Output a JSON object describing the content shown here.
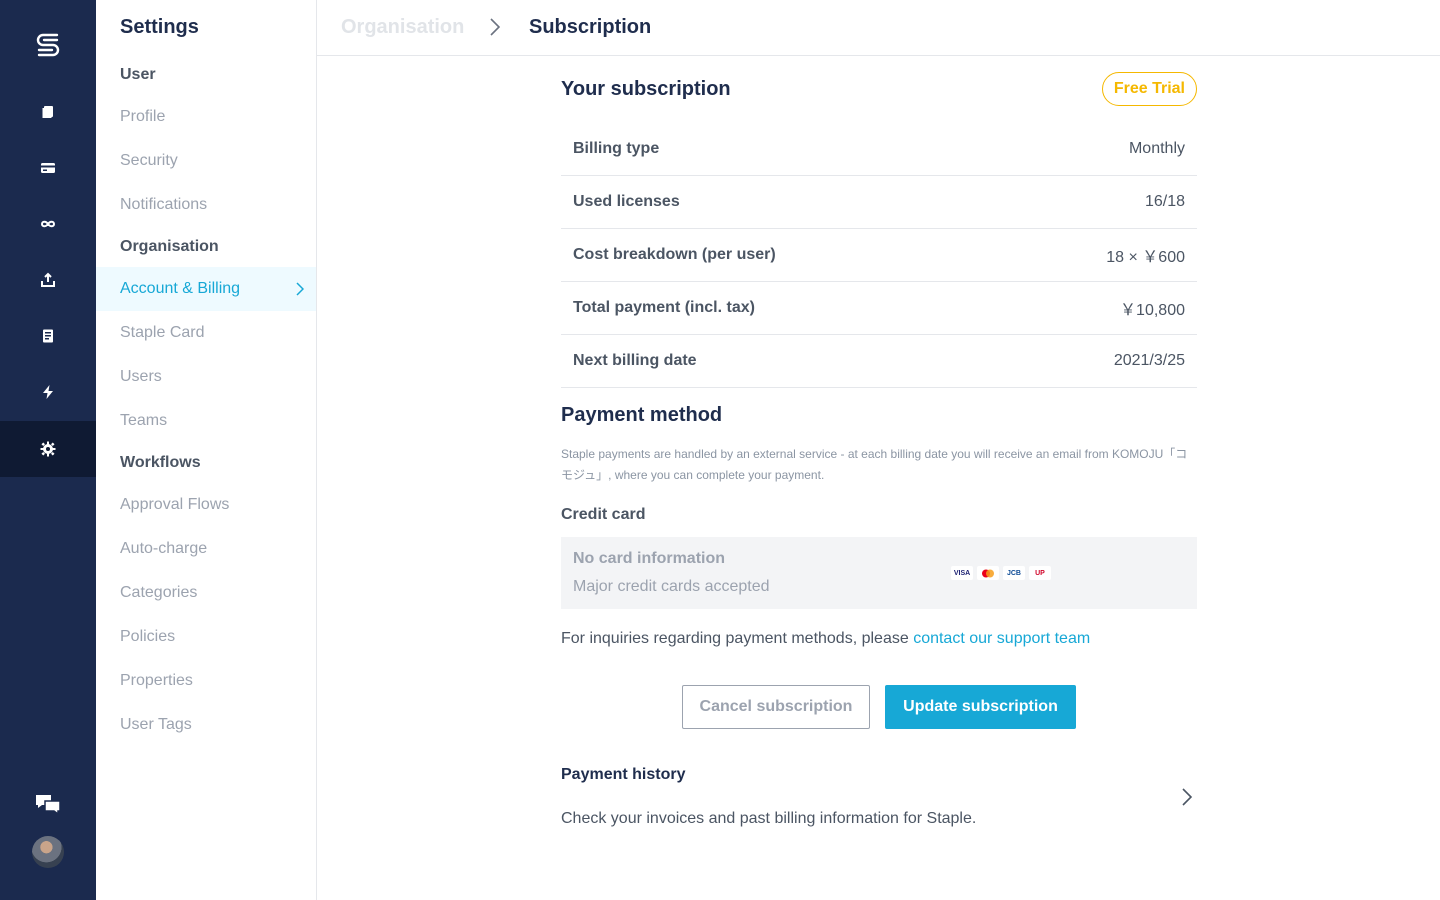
{
  "rail": {
    "logo": "staple-logo",
    "items": [
      {
        "icon": "documents-icon"
      },
      {
        "icon": "card-icon"
      },
      {
        "icon": "link-icon"
      },
      {
        "icon": "upload-icon"
      },
      {
        "icon": "receipt-icon"
      },
      {
        "icon": "bolt-icon"
      },
      {
        "icon": "gear-icon",
        "active": true
      }
    ],
    "chat_icon": "chat-icon",
    "avatar": "avatar"
  },
  "sidebar": {
    "title": "Settings",
    "sections": {
      "user": "User",
      "organisation": "Organisation",
      "workflows": "Workflows"
    },
    "items": [
      {
        "label": "Profile"
      },
      {
        "label": "Security"
      },
      {
        "label": "Notifications"
      },
      {
        "label": "Account & Billing",
        "active": true
      },
      {
        "label": "Staple Card"
      },
      {
        "label": "Users"
      },
      {
        "label": "Teams"
      },
      {
        "label": "Approval Flows"
      },
      {
        "label": "Auto-charge"
      },
      {
        "label": "Categories"
      },
      {
        "label": "Policies"
      },
      {
        "label": "Properties"
      },
      {
        "label": "User Tags"
      }
    ]
  },
  "header": {
    "parent": "Organisation",
    "current": "Subscription"
  },
  "subscription": {
    "title": "Your subscription",
    "badge": "Free Trial",
    "rows": [
      {
        "label": "Billing type",
        "value": "Monthly"
      },
      {
        "label": "Used licenses",
        "value": "16/18"
      },
      {
        "label": "Cost breakdown (per user)",
        "value": "18 × ￥600"
      },
      {
        "label": "Total payment (incl. tax)",
        "value": "￥10,800"
      },
      {
        "label": "Next billing date",
        "value": "2021/3/25"
      }
    ]
  },
  "payment_method": {
    "title": "Payment method",
    "note": "Staple payments are handled by an external service - at each billing date you will receive an email from KOMOJU「コモジュ」, where you can complete your payment.",
    "credit_card_label": "Credit card",
    "no_card": "No card information",
    "accepted": "Major credit cards accepted",
    "brands": [
      {
        "icon": "visa-icon",
        "text": "VISA",
        "color": "#1a1f71"
      },
      {
        "icon": "mastercard-icon",
        "text": "",
        "color": "#eb001b"
      },
      {
        "icon": "jcb-icon",
        "text": "JCB",
        "color": "#0e4c96"
      },
      {
        "icon": "unionpay-icon",
        "text": "UP",
        "color": "#d10429"
      }
    ],
    "inquiry_text": "For inquiries regarding payment methods, please ",
    "inquiry_link": "contact our support team"
  },
  "actions": {
    "cancel": "Cancel subscription",
    "update": "Update subscription"
  },
  "payment_history": {
    "title": "Payment history",
    "description": "Check your invoices and past billing information for Staple."
  },
  "colors": {
    "rail": "#1b2a4e",
    "accent": "#17a8d6",
    "badge": "#f5b800"
  }
}
